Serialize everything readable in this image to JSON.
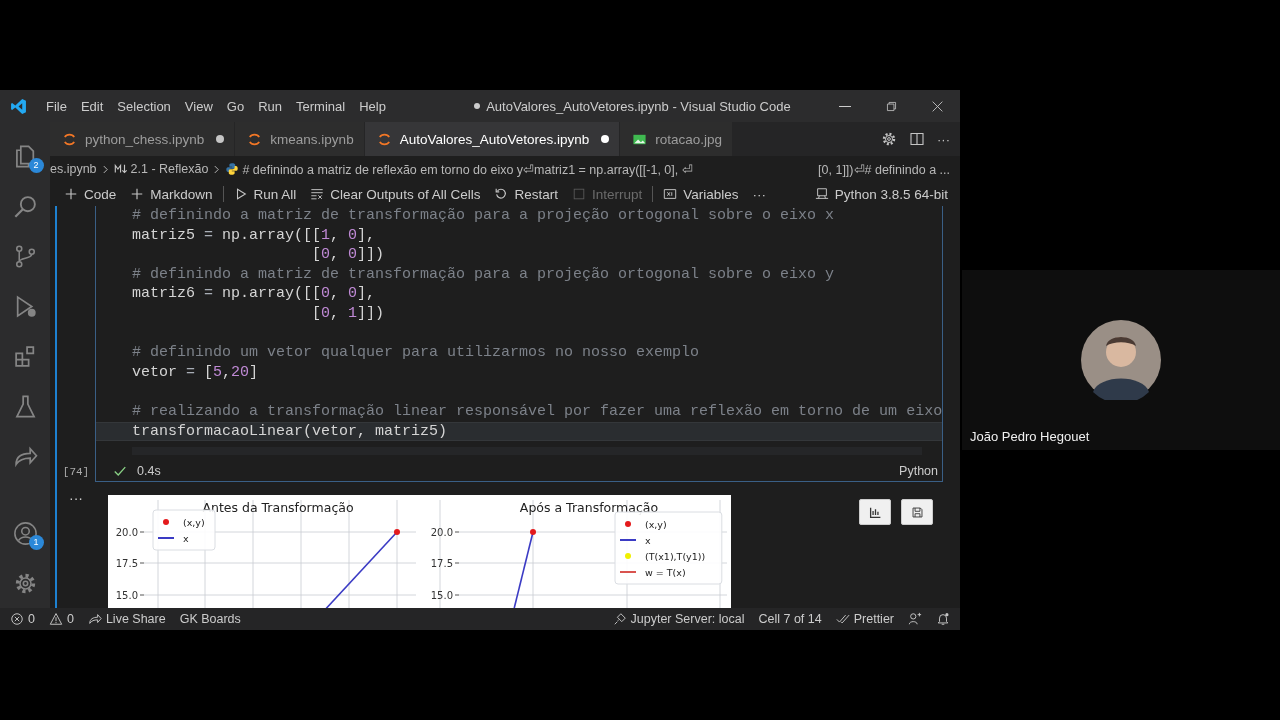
{
  "window": {
    "title": "AutoValores_AutoVetores.ipynb - Visual Studio Code",
    "modified": true
  },
  "menu": [
    "File",
    "Edit",
    "Selection",
    "View",
    "Go",
    "Run",
    "Terminal",
    "Help"
  ],
  "activity_bar": [
    {
      "kind": "files",
      "badge": "2"
    },
    {
      "kind": "search"
    },
    {
      "kind": "branch"
    },
    {
      "kind": "debug"
    },
    {
      "kind": "blocks"
    },
    {
      "kind": "flask"
    },
    {
      "kind": "share"
    },
    {
      "kind": "account",
      "badge": "1"
    },
    {
      "kind": "gear"
    }
  ],
  "tabs": [
    {
      "label": "python_chess.ipynb",
      "kind": "notebook",
      "selected": false,
      "modified": true
    },
    {
      "label": "kmeans.ipynb",
      "kind": "notebook",
      "selected": false,
      "modified": false
    },
    {
      "label": "AutoValores_AutoVetores.ipynb",
      "kind": "notebook",
      "selected": true,
      "modified": true
    },
    {
      "label": "rotacao.jpg",
      "kind": "image",
      "selected": false,
      "modified": false
    }
  ],
  "tab_actions": {
    "more": "···"
  },
  "breadcrumb": {
    "items": [
      {
        "kind": "file",
        "text": "es.ipynb"
      },
      {
        "kind": "markdown",
        "text": "2.1 - Reflexão"
      },
      {
        "kind": "python",
        "text": "# definindo a matriz de reflexão em torno do eixo y⏎matriz1 = np.array([[-1, 0], ⏎"
      }
    ],
    "tail": "[0, 1]])⏎# definindo a ..."
  },
  "toolbar": [
    {
      "kind": "add",
      "label": "Code"
    },
    {
      "kind": "add",
      "label": "Markdown"
    },
    {
      "kind": "separator"
    },
    {
      "kind": "run",
      "label": "Run All"
    },
    {
      "kind": "clear",
      "label": "Clear Outputs of All Cells"
    },
    {
      "kind": "restart",
      "label": "Restart"
    },
    {
      "kind": "interrupt",
      "label": "Interrupt",
      "disabled": true
    },
    {
      "kind": "separator"
    },
    {
      "kind": "variables",
      "label": "Variables"
    },
    {
      "kind": "more",
      "label": "···"
    }
  ],
  "kernel": "Python 3.8.5 64-bit",
  "cell": {
    "execution_count": "[74]",
    "success": true,
    "duration": "0.4s",
    "language": "Python",
    "lines": [
      {
        "kind": "code",
        "active": false,
        "tokens": [
          {
            "kind": "comment",
            "text": "# definindo a matriz de transformação para a projeção ortogonal sobre o eixo x"
          }
        ]
      },
      {
        "kind": "code",
        "active": false,
        "tokens": [
          {
            "kind": "plain",
            "text": "matriz5 "
          },
          {
            "kind": "op",
            "text": "="
          },
          {
            "kind": "plain",
            "text": " np.array([["
          },
          {
            "kind": "num",
            "text": "1"
          },
          {
            "kind": "plain",
            "text": ", "
          },
          {
            "kind": "num",
            "text": "0"
          },
          {
            "kind": "plain",
            "text": "],"
          }
        ]
      },
      {
        "kind": "code",
        "active": false,
        "tokens": [
          {
            "kind": "plain",
            "text": "                    ["
          },
          {
            "kind": "num",
            "text": "0"
          },
          {
            "kind": "plain",
            "text": ", "
          },
          {
            "kind": "num",
            "text": "0"
          },
          {
            "kind": "plain",
            "text": "]])"
          }
        ]
      },
      {
        "kind": "code",
        "active": false,
        "tokens": [
          {
            "kind": "comment",
            "text": "# definindo a matriz de transformação para a projeção ortogonal sobre o eixo y"
          }
        ]
      },
      {
        "kind": "code",
        "active": false,
        "tokens": [
          {
            "kind": "plain",
            "text": "matriz6 "
          },
          {
            "kind": "op",
            "text": "="
          },
          {
            "kind": "plain",
            "text": " np.array([["
          },
          {
            "kind": "num",
            "text": "0"
          },
          {
            "kind": "plain",
            "text": ", "
          },
          {
            "kind": "num",
            "text": "0"
          },
          {
            "kind": "plain",
            "text": "],"
          }
        ]
      },
      {
        "kind": "code",
        "active": false,
        "tokens": [
          {
            "kind": "plain",
            "text": "                    ["
          },
          {
            "kind": "num",
            "text": "0"
          },
          {
            "kind": "plain",
            "text": ", "
          },
          {
            "kind": "num",
            "text": "1"
          },
          {
            "kind": "plain",
            "text": "]])"
          }
        ]
      },
      {
        "kind": "blank",
        "active": false
      },
      {
        "kind": "code",
        "active": false,
        "tokens": [
          {
            "kind": "comment",
            "text": "# definindo um vetor qualquer para utilizarmos no nosso exemplo"
          }
        ]
      },
      {
        "kind": "code",
        "active": false,
        "tokens": [
          {
            "kind": "plain",
            "text": "vetor "
          },
          {
            "kind": "op",
            "text": "="
          },
          {
            "kind": "plain",
            "text": " ["
          },
          {
            "kind": "num",
            "text": "5"
          },
          {
            "kind": "plain",
            "text": ","
          },
          {
            "kind": "num",
            "text": "20"
          },
          {
            "kind": "plain",
            "text": "]"
          }
        ]
      },
      {
        "kind": "blank",
        "active": false
      },
      {
        "kind": "code",
        "active": false,
        "tokens": [
          {
            "kind": "comment",
            "text": "# realizando a transformação linear responsável por fazer uma reflexão em torno de um eixo"
          }
        ]
      },
      {
        "kind": "code",
        "active": true,
        "tokens": [
          {
            "kind": "plain",
            "text": "transformacaoLinear(vetor, matriz5)"
          }
        ]
      }
    ]
  },
  "output": {
    "more": "···",
    "plots": [
      {
        "title": "Antes da Transformação",
        "y_tick_labels": [
          "20.0",
          "17.5",
          "15.0"
        ],
        "legend": [
          {
            "kind": "dot",
            "label": "(x,y)",
            "color": "#e41a1c"
          },
          {
            "kind": "line",
            "label": "x",
            "color": "#3b3bc4"
          }
        ]
      },
      {
        "title": "Após a Transformação",
        "y_tick_labels": [
          "20.0",
          "17.5",
          "15.0"
        ],
        "legend": [
          {
            "kind": "dot",
            "label": "(x,y)",
            "color": "#e41a1c"
          },
          {
            "kind": "line",
            "label": "x",
            "color": "#3b3bc4"
          },
          {
            "kind": "dot",
            "label": "(T(x1),T(y1))",
            "color": "#f0f000"
          },
          {
            "kind": "line",
            "label": "w = T(x)",
            "color": "#d9534f"
          }
        ]
      }
    ],
    "buttons": [
      {
        "kind": "chart"
      },
      {
        "kind": "save"
      }
    ]
  },
  "status_bar": {
    "left": [
      {
        "kind": "errors",
        "text": "0"
      },
      {
        "kind": "warnings",
        "text": "0"
      },
      {
        "kind": "live-share",
        "text": "Live Share"
      },
      {
        "kind": "plain",
        "text": "GK Boards"
      }
    ],
    "right": [
      {
        "kind": "jupyter",
        "text": "Jupyter Server: local"
      },
      {
        "kind": "plain",
        "text": "Cell 7 of 14"
      },
      {
        "kind": "prettier",
        "text": "Prettier"
      },
      {
        "kind": "feedback"
      },
      {
        "kind": "bell"
      }
    ]
  },
  "participant": {
    "name": "João Pedro Hegouet"
  }
}
